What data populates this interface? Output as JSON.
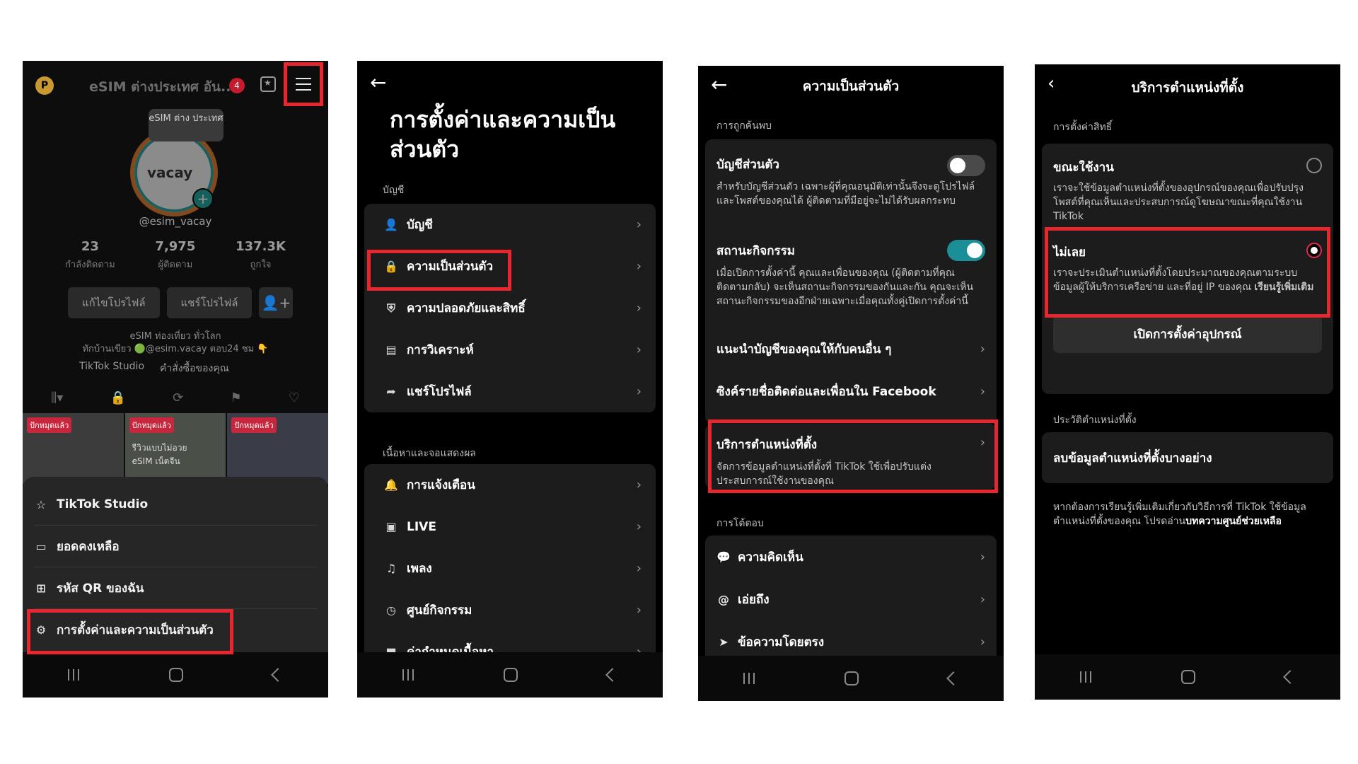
{
  "panel1": {
    "avatar_letter": "P",
    "title": "eSIM ต่างประเทศ อัน...",
    "notif_count": "4",
    "bubble": "eSIM ต่าง ประเทศ",
    "logo": "vacay",
    "handle": "@esim_vacay",
    "stats": [
      {
        "num": "23",
        "label": "กำลังติดตาม"
      },
      {
        "num": "7,975",
        "label": "ผู้ติดตาม"
      },
      {
        "num": "137.3K",
        "label": "ถูกใจ"
      }
    ],
    "edit_profile": "แก้ไขโปรไฟล์",
    "share_profile": "แชร์โปรไฟล์",
    "bio_line1": "eSIM ท่องเที่ยว ทั่วโลก",
    "bio_line2": "ทักบ้านเขียว 🟢@esim.vacay ตอบ24 ชม 👇",
    "studio_link": "TikTok Studio",
    "orders_link": "คำสั่งซื้อของคุณ",
    "thumb_tag": "ปักหมุดแล้ว",
    "thumb_text": "รีวิวแบบไม่อวย eSIM เน็ตจีน",
    "sheet_items": [
      "TikTok Studio",
      "ยอดคงเหลือ",
      "รหัส QR ของฉัน",
      "การตั้งค่าและความเป็นส่วนตัว"
    ]
  },
  "panel2": {
    "title": "การตั้งค่าและความเป็นส่วนตัว",
    "section_account": "บัญชี",
    "account_items": [
      "บัญชี",
      "ความเป็นส่วนตัว",
      "ความปลอดภัยและสิทธิ์",
      "การวิเคราะห์",
      "แชร์โปรไฟล์"
    ],
    "section_content": "เนื้อหาและจอแสดงผล",
    "content_items": [
      "การแจ้งเตือน",
      "LIVE",
      "เพลง",
      "ศูนย์กิจกรรม",
      "ค่ากำหนดเนื้อหา"
    ]
  },
  "panel3": {
    "title": "ความเป็นส่วนตัว",
    "section_discover": "การถูกค้นพบ",
    "private_title": "บัญชีส่วนตัว",
    "private_desc": "สำหรับบัญชีส่วนตัว เฉพาะผู้ที่คุณอนุมัติเท่านั้นจึงจะดูโปรไฟล์และโพสต์ของคุณได้ ผู้ติดตามที่มีอยู่จะไม่ได้รับผลกระทบ",
    "activity_title": "สถานะกิจกรรม",
    "activity_desc": "เมื่อเปิดการตั้งค่านี้ คุณและเพื่อนของคุณ (ผู้ติดตามที่คุณติดตามกลับ) จะเห็นสถานะกิจกรรมของกันและกัน คุณจะเห็นสถานะกิจกรรมของอีกฝ่ายเฉพาะเมื่อคุณทั้งคู่เปิดการตั้งค่านี้",
    "suggest": "แนะนำบัญชีของคุณให้กับคนอื่น ๆ",
    "sync": "ซิงค์รายชื่อติดต่อและเพื่อนใน Facebook",
    "location_title": "บริการตำแหน่งที่ตั้ง",
    "location_desc": "จัดการข้อมูลตำแหน่งที่ตั้งที่ TikTok ใช้เพื่อปรับแต่งประสบการณ์ใช้งานของคุณ",
    "section_interact": "การโต้ตอบ",
    "interact_items": [
      "ความคิดเห็น",
      "เอ่ยถึง",
      "ข้อความโดยตรง"
    ]
  },
  "panel4": {
    "title": "บริการตำแหน่งที่ตั้ง",
    "section_perm": "การตั้งค่าสิทธิ์",
    "while_title": "ขณะใช้งาน",
    "while_desc": "เราจะใช้ข้อมูลตำแหน่งที่ตั้งของอุปกรณ์ของคุณเพื่อปรับปรุงโพสต์ที่คุณเห็นและประสบการณ์ดูโฆษณาขณะที่คุณใช้งาน TikTok",
    "never_title": "ไม่เลย",
    "never_desc": "เราจะประเมินตำแหน่งที่ตั้งโดยประมาณของคุณตามระบบข้อมูลผู้ให้บริการเครือข่าย และที่อยู่ IP ของคุณ",
    "never_more": "เรียนรู้เพิ่มเติม",
    "open_settings": "เปิดการตั้งค่าอุปกรณ์",
    "section_history": "ประวัติตำแหน่งที่ตั้ง",
    "delete_item": "ลบข้อมูลตำแหน่งที่ตั้งบางอย่าง",
    "footer_text": "หากต้องการเรียนรู้เพิ่มเติมเกี่ยวกับวิธีการที่ TikTok ใช้ข้อมูลตำแหน่งที่ตั้งของคุณ โปรดอ่าน",
    "footer_link": "บทความศูนย์ช่วยเหลือ"
  },
  "colors": {
    "highlight": "#e8262d",
    "toggle_on": "#1b8f98",
    "radio_on": "#e8264e"
  },
  "icons": [
    "menu-icon",
    "back-arrow-icon",
    "chevron-right-icon",
    "toggle",
    "radio"
  ]
}
